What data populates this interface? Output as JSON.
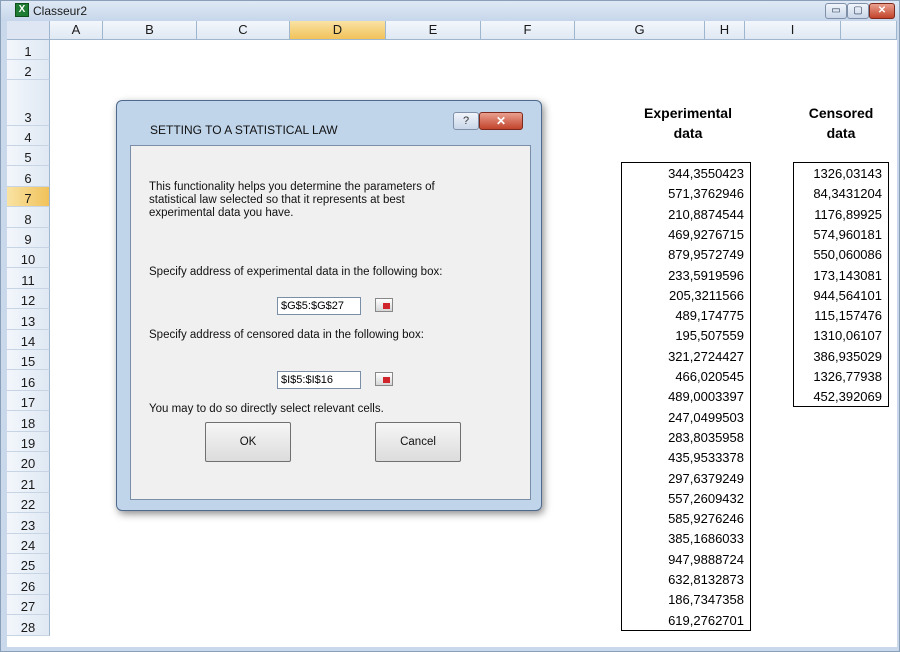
{
  "window": {
    "title": "Classeur2",
    "minimize": "▭",
    "maximize": "▢",
    "close": "✕",
    "app_icon": "X"
  },
  "columns": [
    "A",
    "B",
    "C",
    "D",
    "E",
    "F",
    "G",
    "H",
    "I"
  ],
  "selected_column": "D",
  "rows": [
    "1",
    "2",
    "3",
    "4",
    "5",
    "6",
    "7",
    "8",
    "9",
    "10",
    "11",
    "12",
    "13",
    "14",
    "15",
    "16",
    "17",
    "18",
    "19",
    "20",
    "21",
    "22",
    "23",
    "24",
    "25",
    "26",
    "27",
    "28"
  ],
  "selected_row": "7",
  "headers": {
    "experimental_line1": "Experimental",
    "experimental_line2": "data",
    "censored_line1": "Censored",
    "censored_line2": "data"
  },
  "experimental_data": [
    "344,3550423",
    "571,3762946",
    "210,8874544",
    "469,9276715",
    "879,9572749",
    "233,5919596",
    "205,3211566",
    "489,174775",
    "195,507559",
    "321,2724427",
    "466,020545",
    "489,0003397",
    "247,0499503",
    "283,8035958",
    "435,9533378",
    "297,6379249",
    "557,2609432",
    "585,9276246",
    "385,1686033",
    "947,9888724",
    "632,8132873",
    "186,7347358",
    "619,2762701"
  ],
  "censored_data": [
    "1326,03143",
    "84,3431204",
    "1176,89925",
    "574,960181",
    "550,060086",
    "173,143081",
    "944,564101",
    "115,157476",
    "1310,06107",
    "386,935029",
    "1326,77938",
    "452,392069"
  ],
  "dialog": {
    "title": "SETTING TO A STATISTICAL LAW",
    "help": "?",
    "close": "✕",
    "intro_line1": "This functionality helps you determine the parameters of",
    "intro_line2": "statistical law selected so that it represents at best",
    "intro_line3": "experimental data you have.",
    "exp_label": "Specify address of experimental data in the following box:",
    "exp_value": "$G$5:$G$27",
    "cens_label": "Specify address of censored data in the following box:",
    "cens_value": "$I$5:$I$16",
    "hint": "You may to do so directly select relevant cells.",
    "ok": "OK",
    "cancel": "Cancel"
  },
  "colors": {
    "selected_header": "#f1c25a",
    "title_bar": "#c6d6ea",
    "close_red": "#c2432b"
  }
}
